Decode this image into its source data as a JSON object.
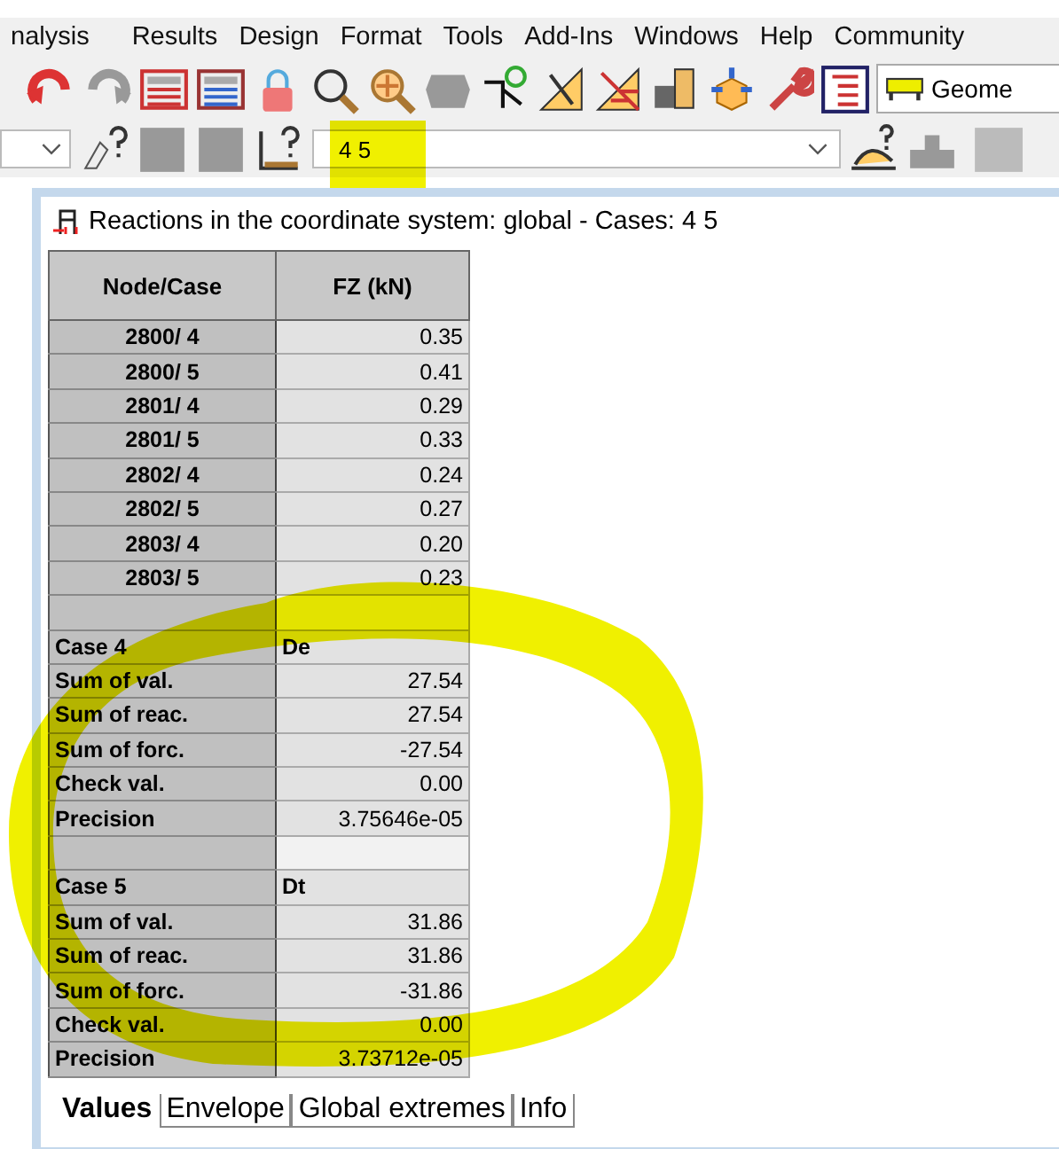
{
  "menu": [
    "nalysis",
    "Results",
    "Design",
    "Format",
    "Tools",
    "Add-Ins",
    "Windows",
    "Help",
    "Community"
  ],
  "toolbar": {
    "view_combo": "Geome"
  },
  "case_field": {
    "value": "4 5"
  },
  "panel": {
    "title": "Reactions in the coordinate system: global - Cases:  4 5",
    "columns": [
      "Node/Case",
      "FZ (kN)"
    ],
    "rows": [
      {
        "kind": "node",
        "label": "2800/ 4",
        "value": "0.35"
      },
      {
        "kind": "node",
        "label": "2800/ 5",
        "value": "0.41"
      },
      {
        "kind": "node",
        "label": "2801/ 4",
        "value": "0.29"
      },
      {
        "kind": "node",
        "label": "2801/ 5",
        "value": "0.33"
      },
      {
        "kind": "node",
        "label": "2802/ 4",
        "value": "0.24"
      },
      {
        "kind": "node",
        "label": "2802/ 5",
        "value": "0.27"
      },
      {
        "kind": "node",
        "label": "2803/ 4",
        "value": "0.20"
      },
      {
        "kind": "node",
        "label": "2803/ 5",
        "value": "0.23"
      },
      {
        "kind": "spacer"
      },
      {
        "kind": "case",
        "label": "Case 4",
        "value": "De"
      },
      {
        "kind": "sum",
        "label": "Sum of val.",
        "value": "27.54"
      },
      {
        "kind": "sum",
        "label": "Sum of reac.",
        "value": "27.54"
      },
      {
        "kind": "sum",
        "label": "Sum of forc.",
        "value": "-27.54"
      },
      {
        "kind": "sum",
        "label": "Check val.",
        "value": "0.00"
      },
      {
        "kind": "sum",
        "label": "Precision",
        "value": "3.75646e-05"
      },
      {
        "kind": "spacer"
      },
      {
        "kind": "case",
        "label": "Case 5",
        "value": "Dt"
      },
      {
        "kind": "sum",
        "label": "Sum of val.",
        "value": "31.86"
      },
      {
        "kind": "sum",
        "label": "Sum of reac.",
        "value": "31.86"
      },
      {
        "kind": "sum",
        "label": "Sum of forc.",
        "value": "-31.86"
      },
      {
        "kind": "sum",
        "label": "Check val.",
        "value": "0.00"
      },
      {
        "kind": "sum",
        "label": "Precision",
        "value": "3.73712e-05"
      }
    ],
    "tabs": [
      {
        "label": "Values",
        "selected": true
      },
      {
        "label": "Envelope",
        "selected": false
      },
      {
        "label": "Global extremes",
        "selected": false
      },
      {
        "label": "Info",
        "selected": false
      }
    ]
  }
}
